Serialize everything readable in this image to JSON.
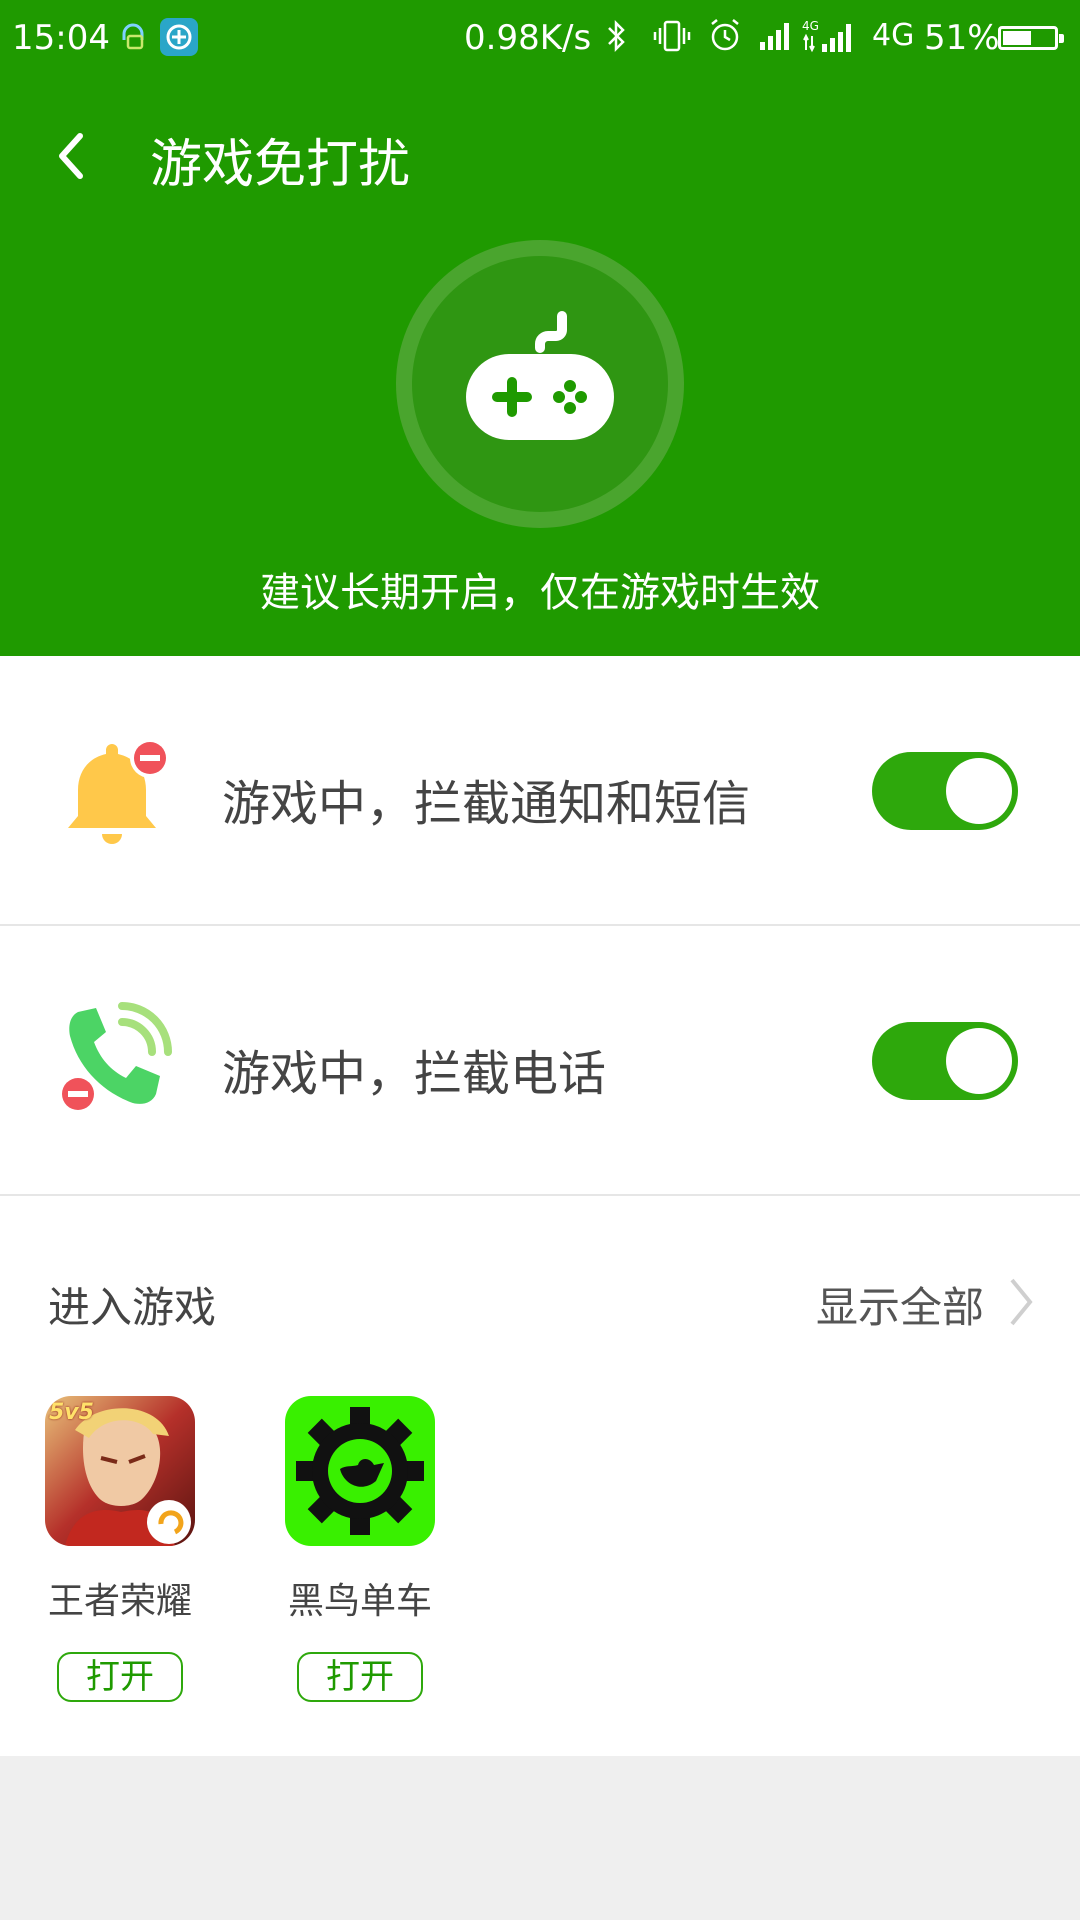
{
  "status_bar": {
    "time": "15:04",
    "speed": "0.98K/s",
    "network": "4G",
    "battery": "51%",
    "battery_level": 0.51,
    "icons": [
      "headset-app-icon",
      "app-notification-icon",
      "bluetooth-icon",
      "vibrate-icon",
      "alarm-icon",
      "signal-icon",
      "signal-4g-icon",
      "battery-icon"
    ]
  },
  "header": {
    "title": "游戏免打扰",
    "back_icon": "back-arrow-icon"
  },
  "hero": {
    "icon": "gamepad-icon",
    "subtitle": "建议长期开启，仅在游戏时生效"
  },
  "settings": [
    {
      "icon": "bell-block-icon",
      "label": "游戏中，拦截通知和短信",
      "enabled": true
    },
    {
      "icon": "phone-block-icon",
      "label": "游戏中，拦截电话",
      "enabled": true
    }
  ],
  "games": {
    "title": "进入游戏",
    "show_all": "显示全部",
    "apps": [
      {
        "name": "王者荣耀",
        "button": "打开",
        "badge": "5v5"
      },
      {
        "name": "黑鸟单车",
        "button": "打开"
      }
    ]
  },
  "colors": {
    "primary_green": "#1f9a00",
    "toggle_green": "#2ea80c",
    "background": "#efefef"
  }
}
